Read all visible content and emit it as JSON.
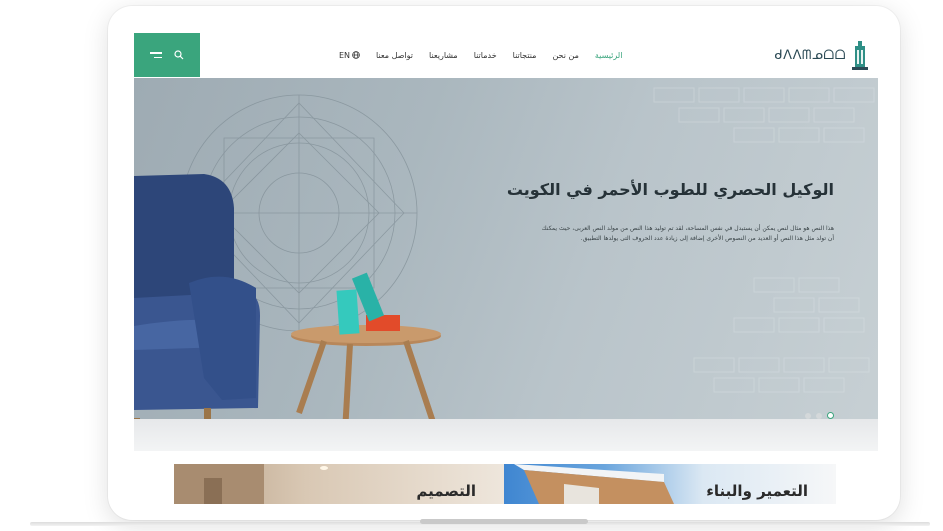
{
  "header": {
    "nav": [
      "الرئيسية",
      "من نحن",
      "منتجاتنا",
      "خدماتنا",
      "مشاريعنا",
      "تواصل معنا"
    ],
    "lang": "EN",
    "logo_text": "ᑯᐱᐱᗰᓄᗝᗝ",
    "search_icon": "search-icon",
    "menu_icon": "hamburger-icon"
  },
  "hero": {
    "title": "الوكيل الحصري للطوب الأحمر في الكويت",
    "description": "هذا النص هو مثال لنص يمكن أن يستبدل في نفس المساحة، لقد تم توليد هذا النص من مولد النص العربى، حيث يمكنك أن تولد مثل هذا النص أو العديد من النصوص الأخرى إضافة إلى زيادة عدد الحروف التى يولدها التطبيق.",
    "slide_count": 3,
    "active_slide": 3
  },
  "cards": {
    "design": "التصميم",
    "construction": "التعمير والبناء"
  },
  "colors": {
    "accent": "#3aa57d"
  }
}
